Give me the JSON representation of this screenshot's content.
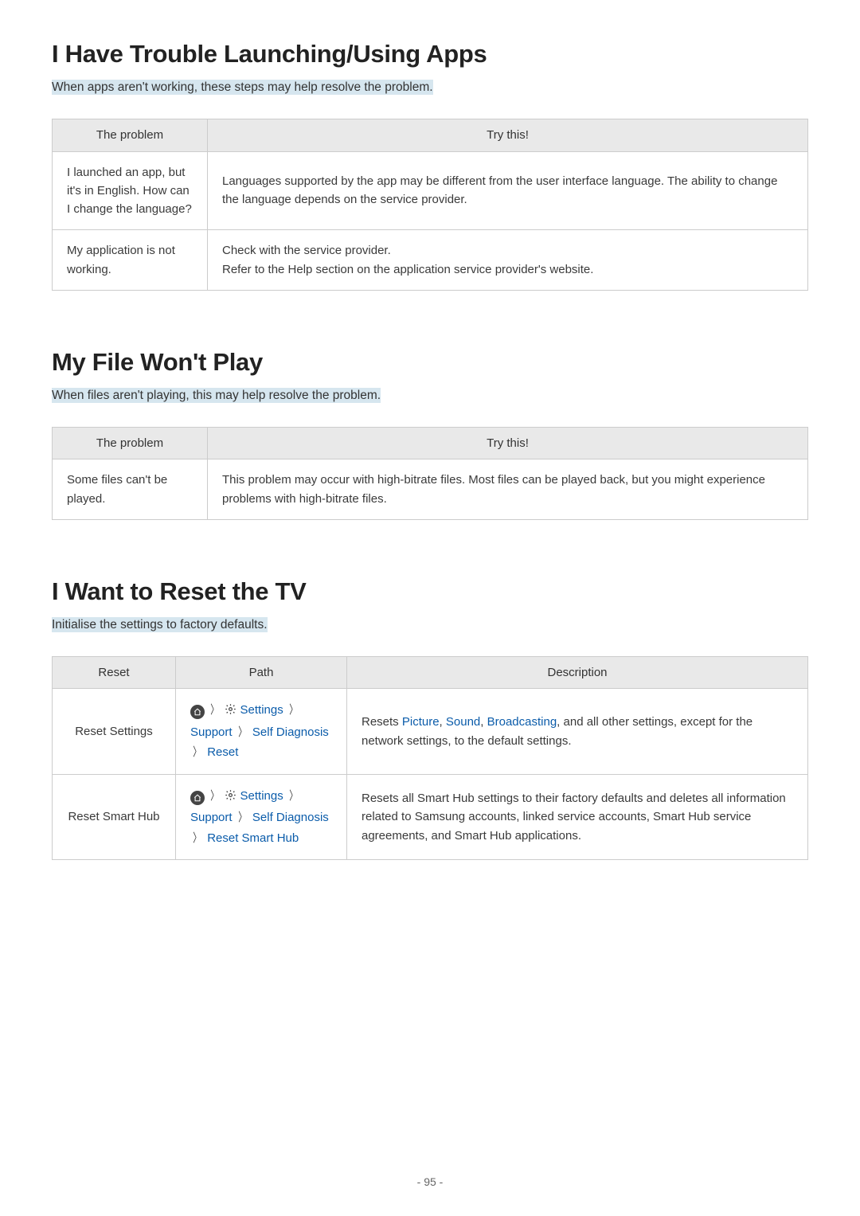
{
  "sections": {
    "apps": {
      "title": "I Have Trouble Launching/Using Apps",
      "subtitle": "When apps aren't working, these steps may help resolve the problem.",
      "headers": {
        "problem": "The problem",
        "try": "Try this!"
      },
      "rows": [
        {
          "problem": "I launched an app, but it's in English. How can I change the language?",
          "try": "Languages supported by the app may be different from the user interface language. The ability to change the language depends on the service provider."
        },
        {
          "problem": "My application is not working.",
          "try": "Check with the service provider.\nRefer to the Help section on the application service provider's website."
        }
      ]
    },
    "file": {
      "title": "My File Won't Play",
      "subtitle": "When files aren't playing, this may help resolve the problem.",
      "headers": {
        "problem": "The problem",
        "try": "Try this!"
      },
      "rows": [
        {
          "problem": "Some files can't be played.",
          "try": "This problem may occur with high-bitrate files. Most files can be played back, but you might experience problems with high-bitrate files."
        }
      ]
    },
    "reset": {
      "title": "I Want to Reset the TV",
      "subtitle": "Initialise the settings to factory defaults.",
      "headers": {
        "reset": "Reset",
        "path": "Path",
        "desc": "Description"
      },
      "rows": [
        {
          "name": "Reset Settings",
          "path_settings": "Settings",
          "path_support": "Support",
          "path_self": "Self Diagnosis",
          "path_leaf": "Reset",
          "desc_prefix": "Resets ",
          "desc_links": {
            "picture": "Picture",
            "sound": "Sound",
            "broadcasting": "Broadcasting"
          },
          "desc_mid1": ", ",
          "desc_mid2": ", ",
          "desc_suffix": ", and all other settings, except for the network settings, to the default settings."
        },
        {
          "name": "Reset Smart Hub",
          "path_settings": "Settings",
          "path_support": "Support",
          "path_self": "Self Diagnosis",
          "path_leaf": "Reset Smart Hub",
          "desc": "Resets all Smart Hub settings to their factory defaults and deletes all information related to Samsung accounts, linked service accounts, Smart Hub service agreements, and Smart Hub applications."
        }
      ]
    }
  },
  "page_number": "- 95 -"
}
